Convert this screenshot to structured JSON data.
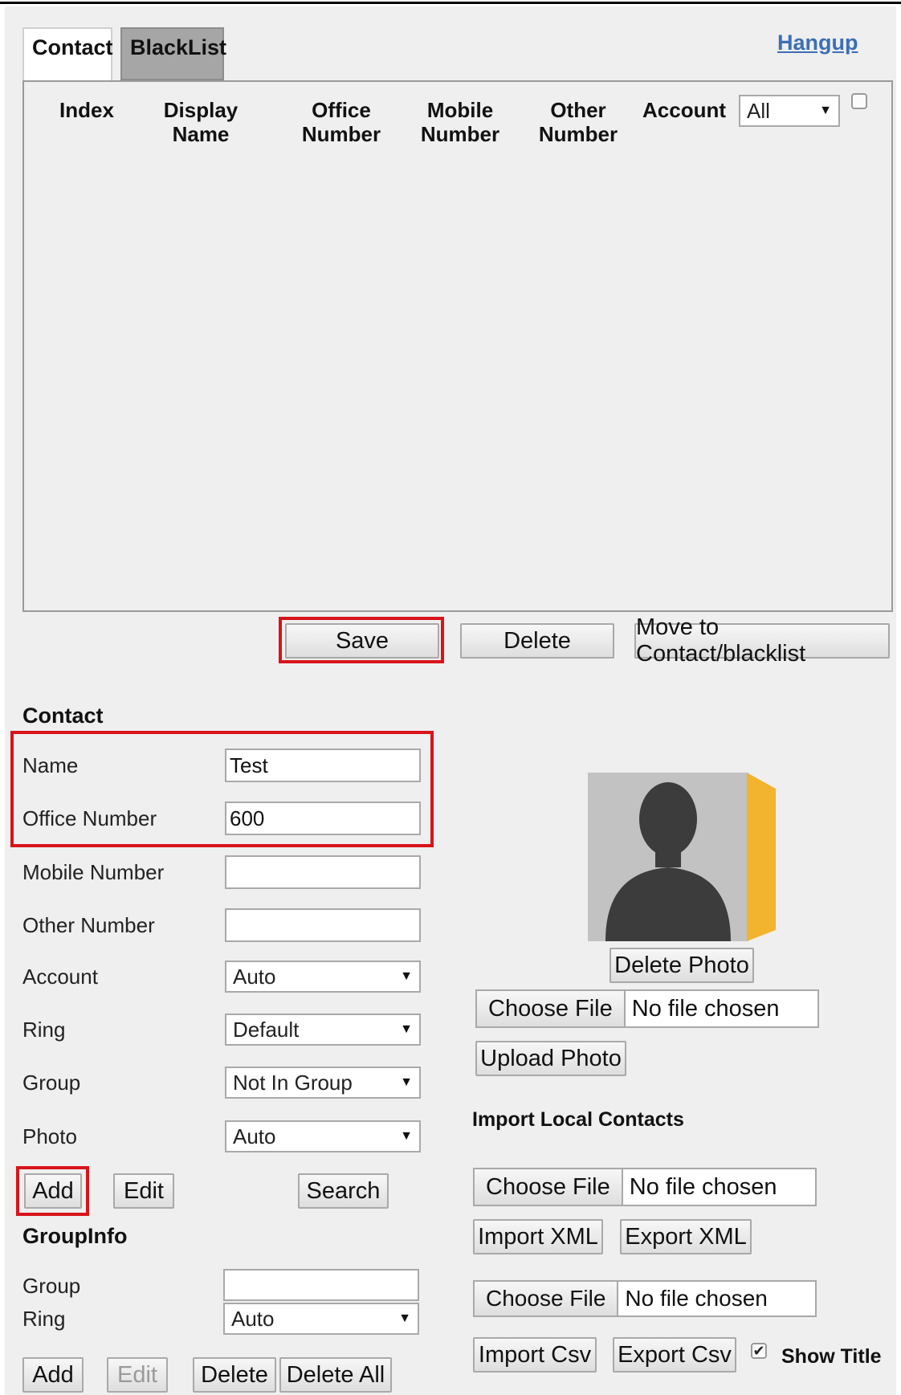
{
  "tabs": {
    "contact": "Contact",
    "blacklist": "BlackList"
  },
  "hangup": "Hangup",
  "table": {
    "headers": {
      "index": "Index",
      "display_name": "Display Name",
      "office_number": "Office\nNumber",
      "mobile_number": "Mobile\nNumber",
      "other_number": "Other\nNumber",
      "account": "Account"
    },
    "account_filter": "All"
  },
  "list_actions": {
    "save": "Save",
    "delete": "Delete",
    "move": "Move to Contact/blacklist"
  },
  "contact_form": {
    "title": "Contact",
    "name_label": "Name",
    "name_value": "Test",
    "office_label": "Office Number",
    "office_value": "600",
    "mobile_label": "Mobile Number",
    "mobile_value": "",
    "other_label": "Other Number",
    "other_value": "",
    "account_label": "Account",
    "account_value": "Auto",
    "ring_label": "Ring",
    "ring_value": "Default",
    "group_label": "Group",
    "group_value": "Not In Group",
    "photo_label": "Photo",
    "photo_value": "Auto",
    "add": "Add",
    "edit": "Edit",
    "search": "Search"
  },
  "photo": {
    "delete_photo": "Delete Photo",
    "choose_file": "Choose File",
    "no_file": "No file chosen",
    "upload_photo": "Upload Photo"
  },
  "import": {
    "title": "Import Local Contacts",
    "choose_file": "Choose File",
    "no_file": "No file chosen",
    "import_xml": "Import XML",
    "export_xml": "Export XML",
    "import_csv": "Import Csv",
    "export_csv": "Export Csv",
    "show_title": "Show Title",
    "show_title_checked": true
  },
  "group_info": {
    "title": "GroupInfo",
    "group_label": "Group",
    "group_value": "",
    "ring_label": "Ring",
    "ring_value": "Auto",
    "add": "Add",
    "edit": "Edit",
    "delete": "Delete",
    "delete_all": "Delete All"
  },
  "colors": {
    "highlight": "#d7141a",
    "link": "#3b6fb6",
    "avatar_accent": "#f2b32e"
  }
}
